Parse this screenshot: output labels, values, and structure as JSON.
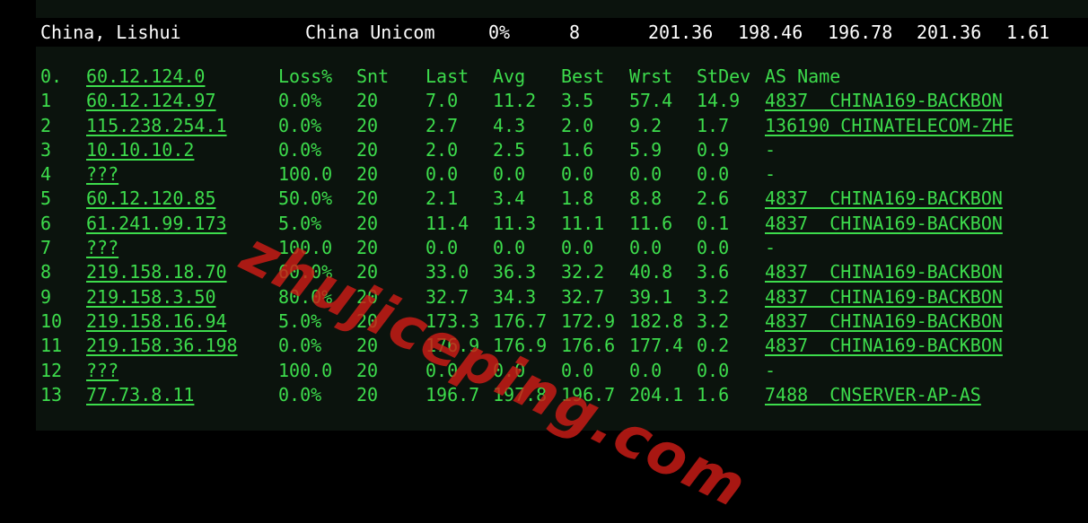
{
  "summary": {
    "location": "China, Lishui",
    "isp": "China Unicom",
    "loss": "0%",
    "sent": "8",
    "last": "201.36",
    "avg": "198.46",
    "best": "196.78",
    "worst": "201.36",
    "stdev": "1.61"
  },
  "header": {
    "hop": "0.",
    "host": "60.12.124.0",
    "loss": "Loss%",
    "snt": "Snt",
    "last": "Last",
    "avg": "Avg",
    "best": "Best",
    "wrst": "Wrst",
    "stdev": "StDev",
    "as_name": "AS Name"
  },
  "rows": [
    {
      "hop": "1",
      "host": "60.12.124.97",
      "loss": "0.0%",
      "snt": "20",
      "last": "7.0",
      "avg": "11.2",
      "best": "3.5",
      "wrst": "57.4",
      "stdev": "14.9",
      "as_name": "4837  CHINA169-BACKBON"
    },
    {
      "hop": "2",
      "host": "115.238.254.1",
      "loss": "0.0%",
      "snt": "20",
      "last": "2.7",
      "avg": "4.3",
      "best": "2.0",
      "wrst": "9.2",
      "stdev": "1.7",
      "as_name": "136190 CHINATELECOM-ZHE"
    },
    {
      "hop": "3",
      "host": "10.10.10.2",
      "loss": "0.0%",
      "snt": "20",
      "last": "2.0",
      "avg": "2.5",
      "best": "1.6",
      "wrst": "5.9",
      "stdev": "0.9",
      "as_name": "-"
    },
    {
      "hop": "4",
      "host": "???",
      "loss": "100.0",
      "snt": "20",
      "last": "0.0",
      "avg": "0.0",
      "best": "0.0",
      "wrst": "0.0",
      "stdev": "0.0",
      "as_name": "-"
    },
    {
      "hop": "5",
      "host": "60.12.120.85",
      "loss": "50.0%",
      "snt": "20",
      "last": "2.1",
      "avg": "3.4",
      "best": "1.8",
      "wrst": "8.8",
      "stdev": "2.6",
      "as_name": "4837  CHINA169-BACKBON"
    },
    {
      "hop": "6",
      "host": "61.241.99.173",
      "loss": "5.0%",
      "snt": "20",
      "last": "11.4",
      "avg": "11.3",
      "best": "11.1",
      "wrst": "11.6",
      "stdev": "0.1",
      "as_name": "4837  CHINA169-BACKBON"
    },
    {
      "hop": "7",
      "host": "???",
      "loss": "100.0",
      "snt": "20",
      "last": "0.0",
      "avg": "0.0",
      "best": "0.0",
      "wrst": "0.0",
      "stdev": "0.0",
      "as_name": "-"
    },
    {
      "hop": "8",
      "host": "219.158.18.70",
      "loss": "60.0%",
      "snt": "20",
      "last": "33.0",
      "avg": "36.3",
      "best": "32.2",
      "wrst": "40.8",
      "stdev": "3.6",
      "as_name": "4837  CHINA169-BACKBON"
    },
    {
      "hop": "9",
      "host": "219.158.3.50",
      "loss": "80.0%",
      "snt": "20",
      "last": "32.7",
      "avg": "34.3",
      "best": "32.7",
      "wrst": "39.1",
      "stdev": "3.2",
      "as_name": "4837  CHINA169-BACKBON"
    },
    {
      "hop": "10",
      "host": "219.158.16.94",
      "loss": "5.0%",
      "snt": "20",
      "last": "173.3",
      "avg": "176.7",
      "best": "172.9",
      "wrst": "182.8",
      "stdev": "3.2",
      "as_name": "4837  CHINA169-BACKBON"
    },
    {
      "hop": "11",
      "host": "219.158.36.198",
      "loss": "0.0%",
      "snt": "20",
      "last": "176.9",
      "avg": "176.9",
      "best": "176.6",
      "wrst": "177.4",
      "stdev": "0.2",
      "as_name": "4837  CHINA169-BACKBON"
    },
    {
      "hop": "12",
      "host": "???",
      "loss": "100.0",
      "snt": "20",
      "last": "0.0",
      "avg": "0.0",
      "best": "0.0",
      "wrst": "0.0",
      "stdev": "0.0",
      "as_name": "-"
    },
    {
      "hop": "13",
      "host": "77.73.8.11",
      "loss": "0.0%",
      "snt": "20",
      "last": "196.7",
      "avg": "197.8",
      "best": "196.7",
      "wrst": "204.1",
      "stdev": "1.6",
      "as_name": "7488  CNSERVER-AP-AS"
    }
  ],
  "watermark": "zhujiceping.com",
  "colors": {
    "text_green": "#3ddc4c",
    "summary_text": "#ffffff",
    "panel_bg": "#0b130d",
    "watermark_red": "#cd1c16"
  }
}
